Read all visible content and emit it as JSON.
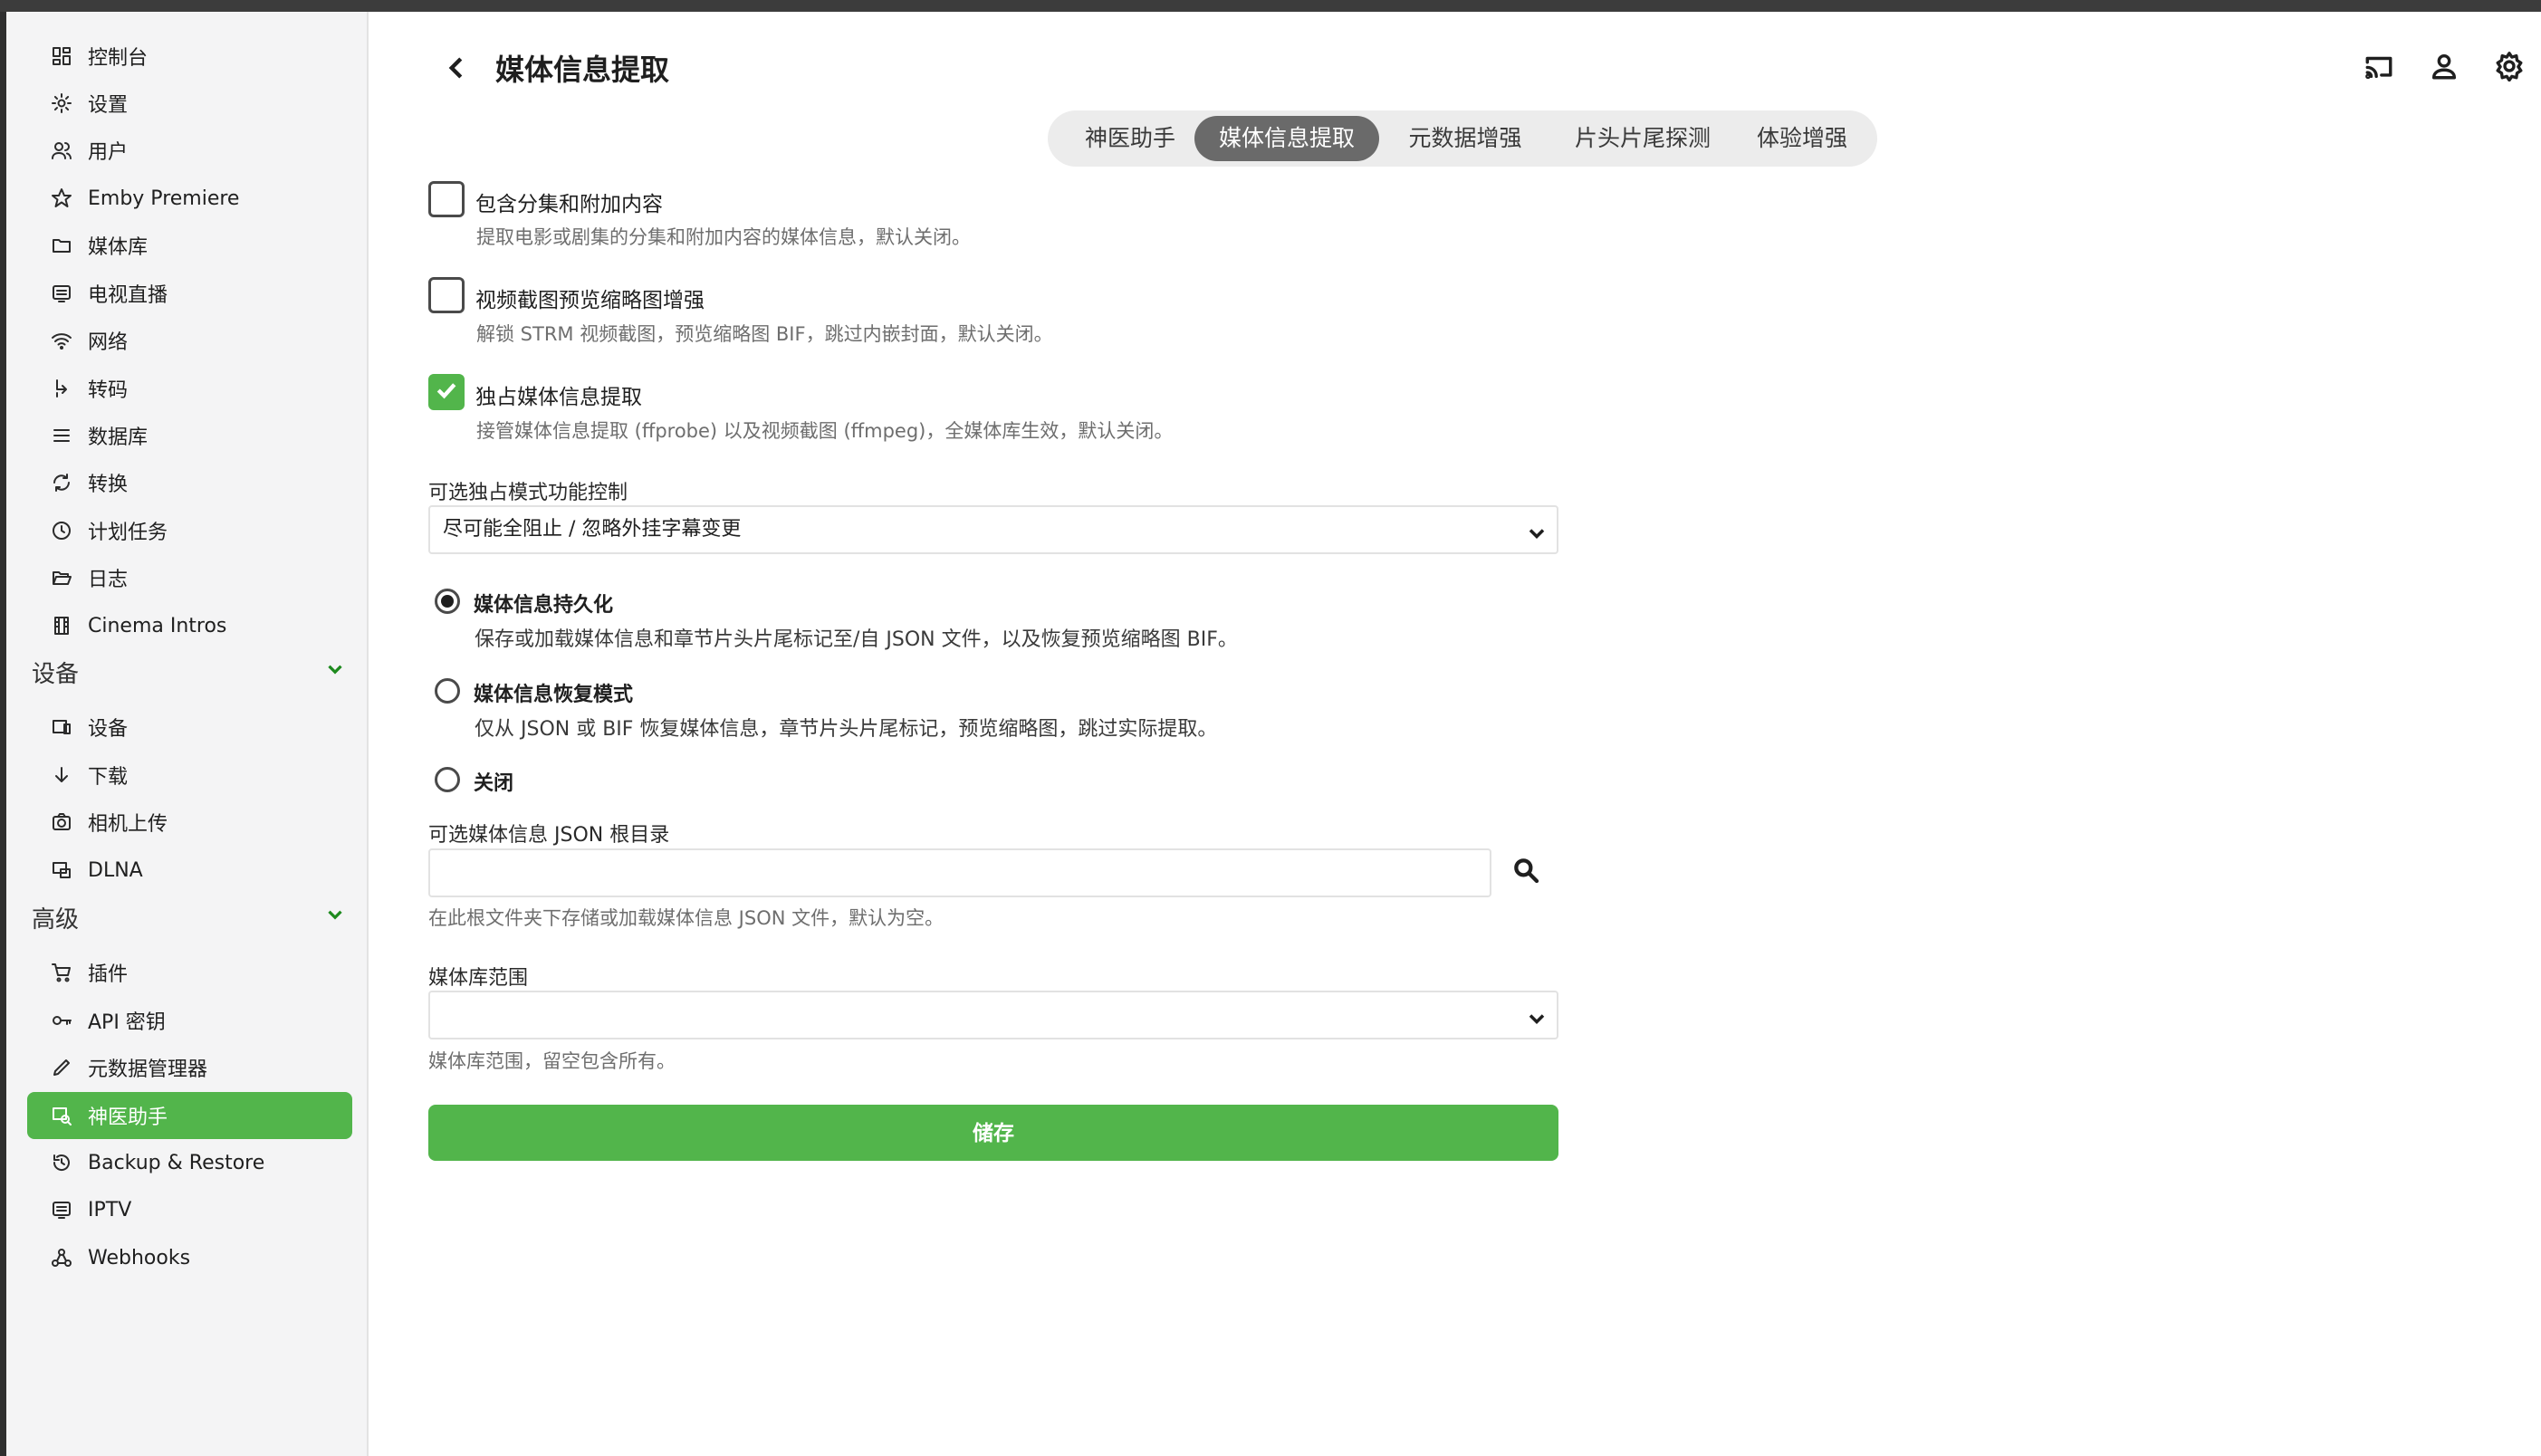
{
  "header": {
    "title": "媒体信息提取",
    "back_icon": "arrow-left-icon",
    "icons": [
      "cast-icon",
      "user-icon",
      "gear-icon"
    ]
  },
  "sidebar": {
    "items": [
      {
        "label": "控制台",
        "icon": "dashboard-icon"
      },
      {
        "label": "设置",
        "icon": "gear-icon"
      },
      {
        "label": "用户",
        "icon": "users-icon"
      },
      {
        "label": "Emby Premiere",
        "icon": "star-icon"
      },
      {
        "label": "媒体库",
        "icon": "folder-icon"
      },
      {
        "label": "电视直播",
        "icon": "tv-guide-icon"
      },
      {
        "label": "网络",
        "icon": "wifi-icon"
      },
      {
        "label": "转码",
        "icon": "transcode-icon"
      },
      {
        "label": "数据库",
        "icon": "list-icon"
      },
      {
        "label": "转换",
        "icon": "convert-icon"
      },
      {
        "label": "计划任务",
        "icon": "clock-icon"
      },
      {
        "label": "日志",
        "icon": "folder-open-icon"
      },
      {
        "label": "Cinema Intros",
        "icon": "film-icon"
      }
    ],
    "section_devices": {
      "title": "设备",
      "items": [
        {
          "label": "设备",
          "icon": "devices-icon"
        },
        {
          "label": "下载",
          "icon": "download-icon"
        },
        {
          "label": "相机上传",
          "icon": "camera-icon"
        },
        {
          "label": "DLNA",
          "icon": "dlna-icon"
        }
      ]
    },
    "section_advanced": {
      "title": "高级",
      "items": [
        {
          "label": "插件",
          "icon": "cart-icon"
        },
        {
          "label": "API 密钥",
          "icon": "key-icon"
        },
        {
          "label": "元数据管理器",
          "icon": "pencil-icon"
        },
        {
          "label": "神医助手",
          "icon": "helper-icon",
          "active": true
        },
        {
          "label": "Backup & Restore",
          "icon": "restore-icon"
        },
        {
          "label": "IPTV",
          "icon": "iptv-icon"
        },
        {
          "label": "Webhooks",
          "icon": "webhook-icon"
        }
      ]
    }
  },
  "tabs": [
    {
      "label": "神医助手",
      "active": false
    },
    {
      "label": "媒体信息提取",
      "active": true
    },
    {
      "label": "元数据增强",
      "active": false
    },
    {
      "label": "片头片尾探测",
      "active": false
    },
    {
      "label": "体验增强",
      "active": false
    }
  ],
  "options": [
    {
      "label": "包含分集和附加内容",
      "description": "提取电影或剧集的分集和附加内容的媒体信息，默认关闭。",
      "checked": false
    },
    {
      "label": "视频截图预览缩略图增强",
      "description": "解锁 STRM 视频截图，预览缩略图 BIF，跳过内嵌封面，默认关闭。",
      "checked": false
    },
    {
      "label": "独占媒体信息提取",
      "description": "接管媒体信息提取 (ffprobe) 以及视频截图 (ffmpeg)，全媒体库生效，默认关闭。",
      "checked": true
    }
  ],
  "exclusive_mode": {
    "label": "可选独占模式功能控制",
    "selected": "尽可能全阻止 / 忽略外挂字幕变更"
  },
  "persistence": [
    {
      "label": "媒体信息持久化",
      "description": "保存或加载媒体信息和章节片头片尾标记至/自 JSON 文件，以及恢复预览缩略图 BIF。",
      "selected": true
    },
    {
      "label": "媒体信息恢复模式",
      "description": "仅从 JSON 或 BIF 恢复媒体信息，章节片头片尾标记，预览缩略图，跳过实际提取。",
      "selected": false
    },
    {
      "label": "关闭",
      "description": "",
      "selected": false
    }
  ],
  "json_root": {
    "label": "可选媒体信息 JSON 根目录",
    "value": "",
    "help": "在此根文件夹下存储或加载媒体信息 JSON 文件，默认为空。"
  },
  "library_scope": {
    "label": "媒体库范围",
    "selected": "",
    "help": "媒体库范围，留空包含所有。"
  },
  "save_label": "储存",
  "colors": {
    "accent": "#52b54b",
    "tab_active": "#6a6a6a"
  }
}
